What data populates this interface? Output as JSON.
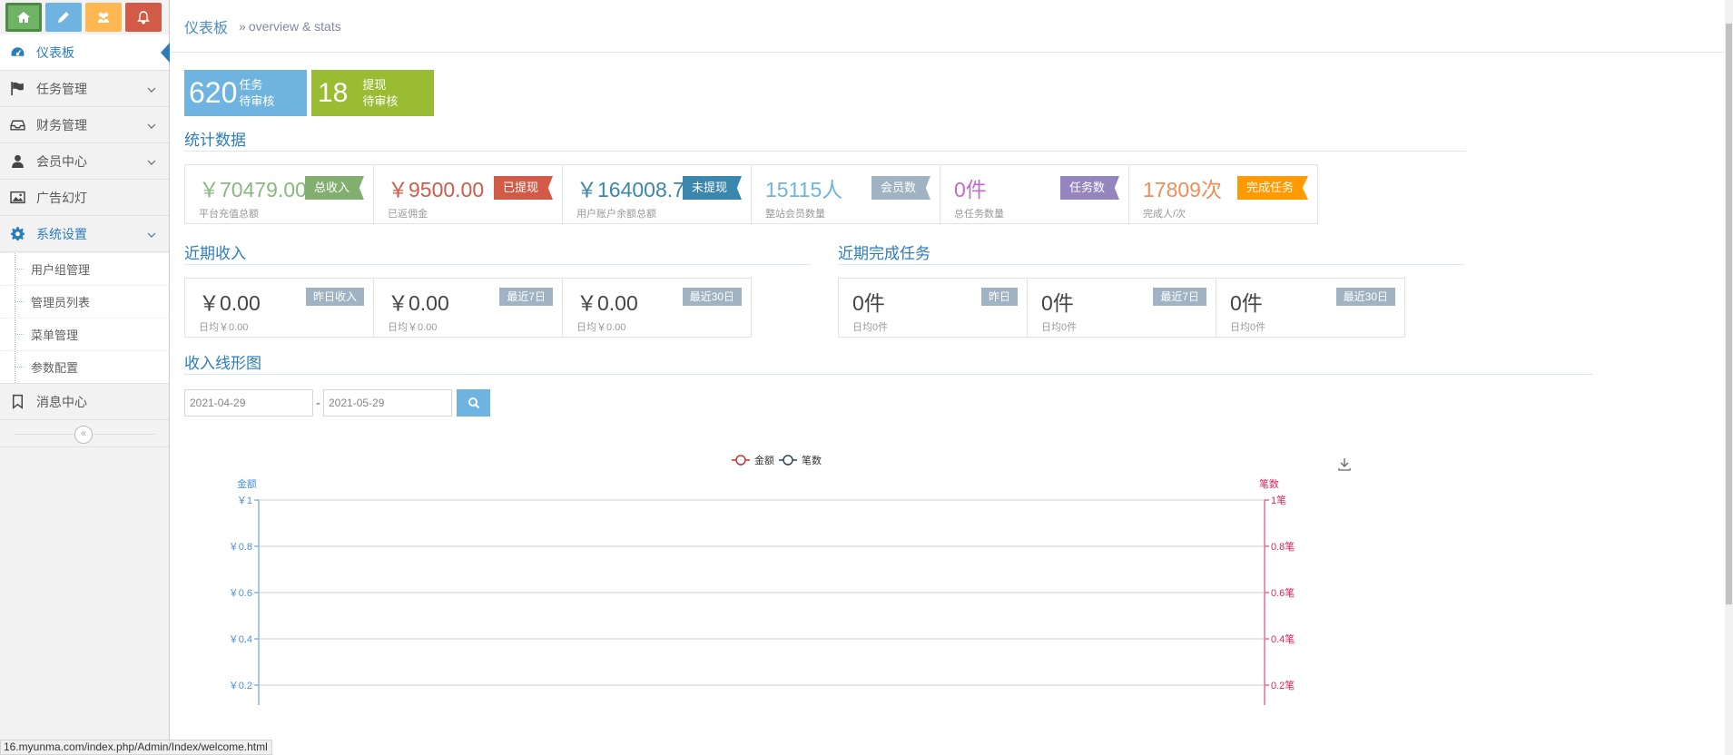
{
  "shortcuts": [
    {
      "name": "home-icon",
      "color": "#6fb365"
    },
    {
      "name": "pencil-icon",
      "color": "#6fb3e0"
    },
    {
      "name": "users-icon",
      "color": "#ffb752"
    },
    {
      "name": "bell-icon",
      "color": "#d15b47"
    }
  ],
  "sidebar": {
    "items": [
      {
        "label": "仪表板",
        "icon": "dashboard-icon"
      },
      {
        "label": "任务管理",
        "icon": "flag-icon"
      },
      {
        "label": "财务管理",
        "icon": "inbox-icon"
      },
      {
        "label": "会员中心",
        "icon": "user-icon"
      },
      {
        "label": "广告幻灯",
        "icon": "image-icon"
      },
      {
        "label": "系统设置",
        "icon": "gear-icon"
      },
      {
        "label": "消息中心",
        "icon": "bookmark-icon"
      }
    ],
    "subitems": [
      "用户组管理",
      "管理员列表",
      "菜单管理",
      "参数配置"
    ],
    "collapse": "«"
  },
  "breadcrumb": {
    "home": "仪表板",
    "sep": "»",
    "sub": "overview & stats"
  },
  "topstats": [
    {
      "value": "620",
      "l1": "任务",
      "l2": "待审核",
      "color": "#6fb3e0"
    },
    {
      "value": "18",
      "l1": "提现",
      "l2": "待审核",
      "color": "#9abc32"
    }
  ],
  "stats_title": "统计数据",
  "stats": [
    {
      "value": "￥70479.00",
      "sub": "平台充值总额",
      "flag": "总收入",
      "color": "#87b87f",
      "flag_color": "#82af6f"
    },
    {
      "value": "￥9500.00",
      "sub": "已返佣金",
      "flag": "已提现",
      "color": "#d15b47",
      "flag_color": "#d15b47"
    },
    {
      "value": "￥164008.7",
      "sub": "用户账户余额总额",
      "flag": "未提现",
      "color": "#3a87ad",
      "flag_color": "#3a87ad"
    },
    {
      "value": "15115人",
      "sub": "整站会员数量",
      "flag": "会员数",
      "color": "#6fb3e0",
      "flag_color": "#a0b3c2"
    },
    {
      "value": "0件",
      "sub": "总任务数量",
      "flag": "任务数",
      "color": "#c568ce",
      "flag_color": "#9585bf"
    },
    {
      "value": "17809次",
      "sub": "完成人/次",
      "flag": "完成任务",
      "color": "#ee8e59",
      "flag_color": "#ff9a00"
    }
  ],
  "income": {
    "title": "近期收入",
    "cards": [
      {
        "value": "￥0.00",
        "sub": "日均￥0.00",
        "tag": "昨日收入"
      },
      {
        "value": "￥0.00",
        "sub": "日均￥0.00",
        "tag": "最近7日"
      },
      {
        "value": "￥0.00",
        "sub": "日均￥0.00",
        "tag": "最近30日"
      }
    ]
  },
  "tasks": {
    "title": "近期完成任务",
    "cards": [
      {
        "value": "0件",
        "sub": "日均0件",
        "tag": "昨日"
      },
      {
        "value": "0件",
        "sub": "日均0件",
        "tag": "最近7日"
      },
      {
        "value": "0件",
        "sub": "日均0件",
        "tag": "最近30日"
      }
    ]
  },
  "chart_section": {
    "title": "收入线形图",
    "date_from": "2021-04-29",
    "date_to": "2021-05-29",
    "dash": "-"
  },
  "chart_data": {
    "type": "line",
    "title": "",
    "legend": [
      {
        "name": "金额",
        "color": "#c23531"
      },
      {
        "name": "笔数",
        "color": "#2f4554"
      }
    ],
    "legend_position": "top-center",
    "left_axis": {
      "label": "金额",
      "color": "#4a90e2",
      "ticks": [
        "￥1",
        "￥0.8",
        "￥0.6",
        "￥0.4",
        "￥0.2"
      ],
      "ylim": [
        0,
        1
      ]
    },
    "right_axis": {
      "label": "笔数",
      "color": "#e0245e",
      "ticks": [
        "1笔",
        "0.8笔",
        "0.6笔",
        "0.4笔",
        "0.2笔"
      ],
      "ylim": [
        0,
        1
      ]
    },
    "series": [
      {
        "name": "金额",
        "values": []
      },
      {
        "name": "笔数",
        "values": []
      }
    ],
    "grid": true
  },
  "statusbar": "16.myunma.com/index.php/Admin/Index/welcome.html"
}
